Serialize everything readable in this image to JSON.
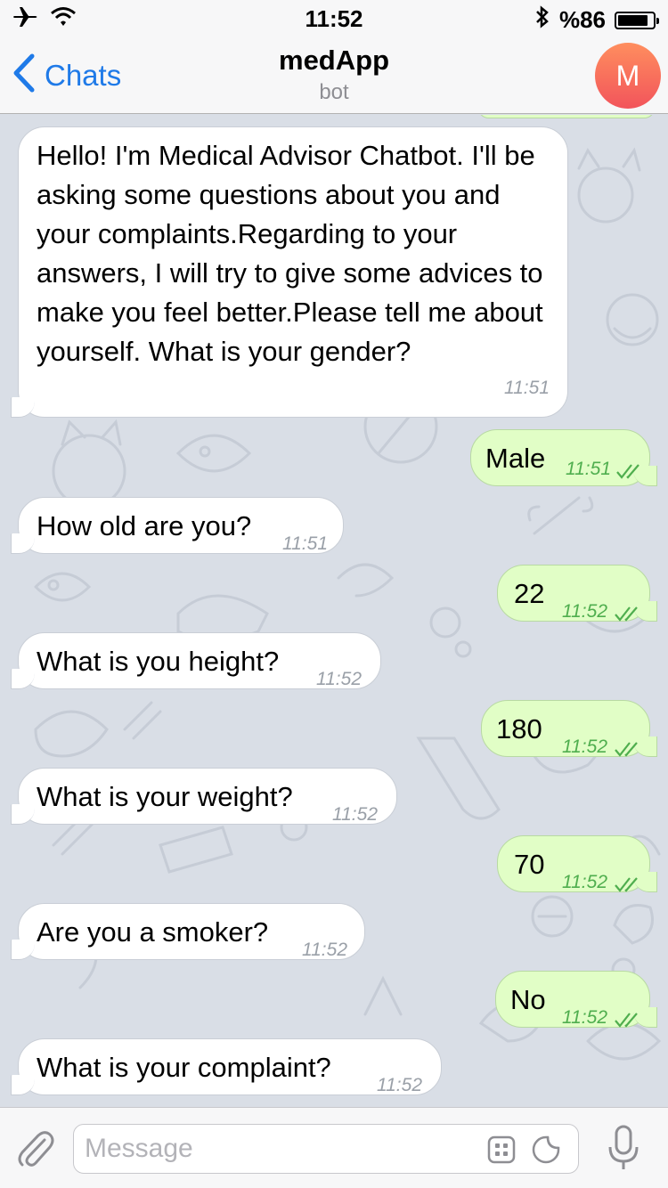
{
  "status_bar": {
    "time": "11:52",
    "battery_text": "%86",
    "battery_level": 0.86
  },
  "header": {
    "back_label": "Chats",
    "title": "medApp",
    "subtitle": "bot",
    "avatar_initial": "M"
  },
  "messages": [
    {
      "direction": "in",
      "text": "Hello! I'm Medical Advisor Chatbot. I'll be asking some questions about you and your complaints.Regarding to your answers, I will try to give some advices to make you feel better.Please tell me about yourself. What is your gender?",
      "time": "11:51"
    },
    {
      "direction": "out",
      "text": "Male",
      "time": "11:51",
      "status": "read"
    },
    {
      "direction": "in",
      "text": "How old are you?",
      "time": "11:51"
    },
    {
      "direction": "out",
      "text": "22",
      "time": "11:52",
      "status": "read"
    },
    {
      "direction": "in",
      "text": "What is you height?",
      "time": "11:52"
    },
    {
      "direction": "out",
      "text": "180",
      "time": "11:52",
      "status": "read"
    },
    {
      "direction": "in",
      "text": "What is your weight?",
      "time": "11:52"
    },
    {
      "direction": "out",
      "text": "70",
      "time": "11:52",
      "status": "read"
    },
    {
      "direction": "in",
      "text": "Are you a smoker?",
      "time": "11:52"
    },
    {
      "direction": "out",
      "text": "No",
      "time": "11:52",
      "status": "read"
    },
    {
      "direction": "in",
      "text": "What is your complaint?",
      "time": "11:52"
    }
  ],
  "input": {
    "placeholder": "Message",
    "value": ""
  },
  "colors": {
    "accent": "#1f7ae8",
    "incoming_bubble": "#ffffff",
    "outgoing_bubble": "#e1fec6",
    "read_check": "#4fae4e",
    "avatar_gradient_top": "#ff8e5e",
    "avatar_gradient_bottom": "#f2545b",
    "chat_background": "#d9dee6"
  },
  "icons": {
    "status_left": [
      "airplane-icon",
      "wifi-icon"
    ],
    "status_right": [
      "bluetooth-icon",
      "battery-icon"
    ],
    "input_bar": [
      "paperclip-icon",
      "keyboard-icon",
      "sticker-icon",
      "microphone-icon"
    ]
  }
}
